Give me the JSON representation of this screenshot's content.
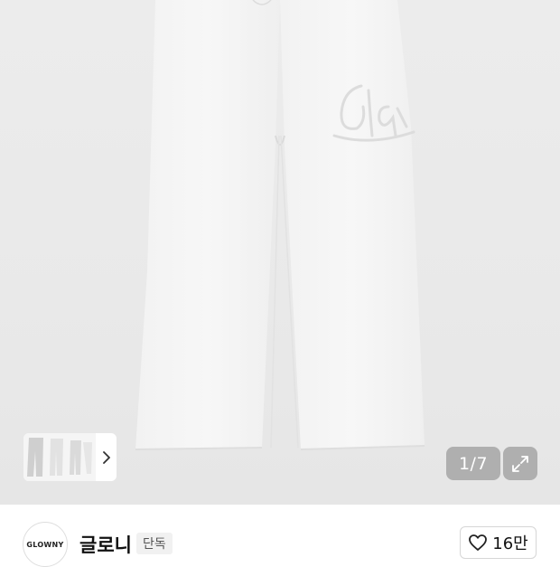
{
  "gallery": {
    "counter": "1/7",
    "thumbnail_next_icon": "chevron-right-icon",
    "expand_icon": "expand-arrows-icon"
  },
  "brand": {
    "logo_text": "GLOWNY",
    "name": "글로니",
    "badge": "단독"
  },
  "like": {
    "icon": "heart-outline-icon",
    "count": "16만"
  },
  "colors": {
    "hero_background": "#e9e9e9",
    "overlay_button": "#8a8a8a",
    "text_primary": "#111111"
  }
}
